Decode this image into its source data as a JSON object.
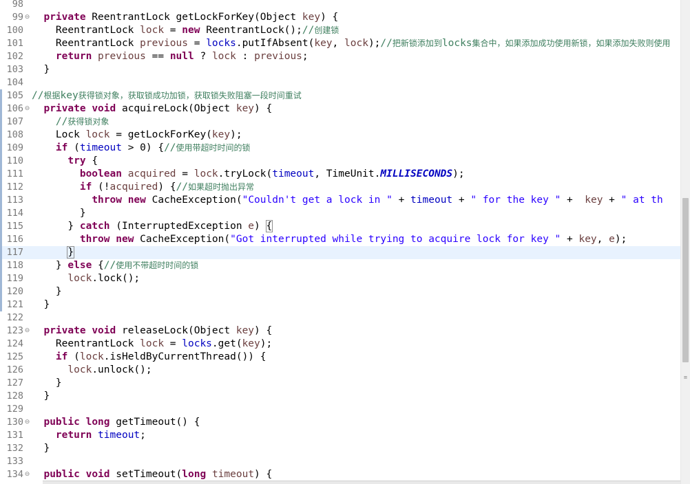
{
  "editor": {
    "lines": [
      {
        "num": "98",
        "fold": "",
        "tokens": []
      },
      {
        "num": "99",
        "fold": "minus",
        "tokens": [
          {
            "t": "  ",
            "c": ""
          },
          {
            "t": "private",
            "c": "kw"
          },
          {
            "t": " ReentrantLock getLockForKey(Object ",
            "c": ""
          },
          {
            "t": "key",
            "c": "var"
          },
          {
            "t": ") {",
            "c": ""
          }
        ]
      },
      {
        "num": "100",
        "fold": "",
        "tokens": [
          {
            "t": "    ReentrantLock ",
            "c": ""
          },
          {
            "t": "lock",
            "c": "var"
          },
          {
            "t": " = ",
            "c": ""
          },
          {
            "t": "new",
            "c": "kw"
          },
          {
            "t": " ReentrantLock();",
            "c": ""
          },
          {
            "t": "//",
            "c": "cmt"
          },
          {
            "t": "创建锁",
            "c": "cn"
          }
        ]
      },
      {
        "num": "101",
        "fold": "",
        "tokens": [
          {
            "t": "    ReentrantLock ",
            "c": ""
          },
          {
            "t": "previous",
            "c": "var"
          },
          {
            "t": " = ",
            "c": ""
          },
          {
            "t": "locks",
            "c": "fld"
          },
          {
            "t": ".putIfAbsent(",
            "c": ""
          },
          {
            "t": "key",
            "c": "var"
          },
          {
            "t": ", ",
            "c": ""
          },
          {
            "t": "lock",
            "c": "var"
          },
          {
            "t": ");",
            "c": ""
          },
          {
            "t": "//",
            "c": "cmt"
          },
          {
            "t": "把新锁添加到",
            "c": "cn"
          },
          {
            "t": "locks",
            "c": "cmt"
          },
          {
            "t": "集合中，如果添加成功使用新锁，如果添加失败则使用",
            "c": "cn"
          }
        ]
      },
      {
        "num": "102",
        "fold": "",
        "tokens": [
          {
            "t": "    ",
            "c": ""
          },
          {
            "t": "return",
            "c": "kw"
          },
          {
            "t": " ",
            "c": ""
          },
          {
            "t": "previous",
            "c": "var"
          },
          {
            "t": " == ",
            "c": ""
          },
          {
            "t": "null",
            "c": "kw"
          },
          {
            "t": " ? ",
            "c": ""
          },
          {
            "t": "lock",
            "c": "var"
          },
          {
            "t": " : ",
            "c": ""
          },
          {
            "t": "previous",
            "c": "var"
          },
          {
            "t": ";",
            "c": ""
          }
        ]
      },
      {
        "num": "103",
        "fold": "",
        "tokens": [
          {
            "t": "  }",
            "c": ""
          }
        ]
      },
      {
        "num": "104",
        "fold": "",
        "tokens": []
      },
      {
        "num": "105",
        "fold": "",
        "changed": true,
        "tokens": [
          {
            "t": "//",
            "c": "cmt"
          },
          {
            "t": "根据",
            "c": "cn"
          },
          {
            "t": "key",
            "c": "cmt"
          },
          {
            "t": "获得锁对象，获取锁成功加锁，获取锁失败阻塞一段时间重试",
            "c": "cn"
          }
        ]
      },
      {
        "num": "106",
        "fold": "minus",
        "changed": true,
        "tokens": [
          {
            "t": "  ",
            "c": ""
          },
          {
            "t": "private",
            "c": "kw"
          },
          {
            "t": " ",
            "c": ""
          },
          {
            "t": "void",
            "c": "kw"
          },
          {
            "t": " acquireLock(Object ",
            "c": ""
          },
          {
            "t": "key",
            "c": "var"
          },
          {
            "t": ") {",
            "c": ""
          }
        ]
      },
      {
        "num": "107",
        "fold": "",
        "changed": true,
        "tokens": [
          {
            "t": "    ",
            "c": ""
          },
          {
            "t": "//",
            "c": "cmt"
          },
          {
            "t": "获得锁对象",
            "c": "cn"
          }
        ]
      },
      {
        "num": "108",
        "fold": "",
        "changed": true,
        "tokens": [
          {
            "t": "    Lock ",
            "c": ""
          },
          {
            "t": "lock",
            "c": "var"
          },
          {
            "t": " = getLockForKey(",
            "c": ""
          },
          {
            "t": "key",
            "c": "var"
          },
          {
            "t": ");",
            "c": ""
          }
        ]
      },
      {
        "num": "109",
        "fold": "",
        "changed": true,
        "tokens": [
          {
            "t": "    ",
            "c": ""
          },
          {
            "t": "if",
            "c": "kw"
          },
          {
            "t": " (",
            "c": ""
          },
          {
            "t": "timeout",
            "c": "fld"
          },
          {
            "t": " > 0) {",
            "c": ""
          },
          {
            "t": "//",
            "c": "cmt"
          },
          {
            "t": "使用带超时时间的锁",
            "c": "cn"
          }
        ]
      },
      {
        "num": "110",
        "fold": "",
        "changed": true,
        "tokens": [
          {
            "t": "      ",
            "c": ""
          },
          {
            "t": "try",
            "c": "kw"
          },
          {
            "t": " {",
            "c": ""
          }
        ]
      },
      {
        "num": "111",
        "fold": "",
        "changed": true,
        "tokens": [
          {
            "t": "        ",
            "c": ""
          },
          {
            "t": "boolean",
            "c": "kw"
          },
          {
            "t": " ",
            "c": ""
          },
          {
            "t": "acquired",
            "c": "var"
          },
          {
            "t": " = ",
            "c": ""
          },
          {
            "t": "lock",
            "c": "var"
          },
          {
            "t": ".tryLock(",
            "c": ""
          },
          {
            "t": "timeout",
            "c": "fld"
          },
          {
            "t": ", TimeUnit.",
            "c": ""
          },
          {
            "t": "MILLISECONDS",
            "c": "cst"
          },
          {
            "t": ");",
            "c": ""
          }
        ]
      },
      {
        "num": "112",
        "fold": "",
        "changed": true,
        "tokens": [
          {
            "t": "        ",
            "c": ""
          },
          {
            "t": "if",
            "c": "kw"
          },
          {
            "t": " (!",
            "c": ""
          },
          {
            "t": "acquired",
            "c": "var"
          },
          {
            "t": ") {",
            "c": ""
          },
          {
            "t": "//",
            "c": "cmt"
          },
          {
            "t": "如果超时抛出异常",
            "c": "cn"
          }
        ]
      },
      {
        "num": "113",
        "fold": "",
        "changed": true,
        "tokens": [
          {
            "t": "          ",
            "c": ""
          },
          {
            "t": "throw",
            "c": "kw"
          },
          {
            "t": " ",
            "c": ""
          },
          {
            "t": "new",
            "c": "kw"
          },
          {
            "t": " CacheException(",
            "c": ""
          },
          {
            "t": "\"Couldn't get a lock in \"",
            "c": "str"
          },
          {
            "t": " + ",
            "c": ""
          },
          {
            "t": "timeout",
            "c": "fld"
          },
          {
            "t": " + ",
            "c": ""
          },
          {
            "t": "\" for the key \"",
            "c": "str"
          },
          {
            "t": " +  ",
            "c": ""
          },
          {
            "t": "key",
            "c": "var"
          },
          {
            "t": " + ",
            "c": ""
          },
          {
            "t": "\" at th",
            "c": "str"
          }
        ]
      },
      {
        "num": "114",
        "fold": "",
        "changed": true,
        "tokens": [
          {
            "t": "        }",
            "c": ""
          }
        ]
      },
      {
        "num": "115",
        "fold": "",
        "changed": true,
        "tokens": [
          {
            "t": "      } ",
            "c": ""
          },
          {
            "t": "catch",
            "c": "kw"
          },
          {
            "t": " (InterruptedException ",
            "c": ""
          },
          {
            "t": "e",
            "c": "var"
          },
          {
            "t": ") ",
            "c": ""
          },
          {
            "t": "{",
            "c": "brk"
          }
        ]
      },
      {
        "num": "116",
        "fold": "",
        "changed": true,
        "tokens": [
          {
            "t": "        ",
            "c": ""
          },
          {
            "t": "throw",
            "c": "kw"
          },
          {
            "t": " ",
            "c": ""
          },
          {
            "t": "new",
            "c": "kw"
          },
          {
            "t": " CacheException(",
            "c": ""
          },
          {
            "t": "\"Got interrupted while trying to acquire lock for key \"",
            "c": "str"
          },
          {
            "t": " + ",
            "c": ""
          },
          {
            "t": "key",
            "c": "var"
          },
          {
            "t": ", ",
            "c": ""
          },
          {
            "t": "e",
            "c": "var"
          },
          {
            "t": ");",
            "c": ""
          }
        ]
      },
      {
        "num": "117",
        "fold": "",
        "changed": true,
        "current": true,
        "tokens": [
          {
            "t": "      ",
            "c": ""
          },
          {
            "t": "}",
            "c": "brk"
          }
        ]
      },
      {
        "num": "118",
        "fold": "",
        "changed": true,
        "tokens": [
          {
            "t": "    } ",
            "c": ""
          },
          {
            "t": "else",
            "c": "kw"
          },
          {
            "t": " {",
            "c": ""
          },
          {
            "t": "//",
            "c": "cmt"
          },
          {
            "t": "使用不带超时时间的锁",
            "c": "cn"
          }
        ]
      },
      {
        "num": "119",
        "fold": "",
        "changed": true,
        "tokens": [
          {
            "t": "      ",
            "c": ""
          },
          {
            "t": "lock",
            "c": "var"
          },
          {
            "t": ".lock();",
            "c": ""
          }
        ]
      },
      {
        "num": "120",
        "fold": "",
        "changed": true,
        "tokens": [
          {
            "t": "    }",
            "c": ""
          }
        ]
      },
      {
        "num": "121",
        "fold": "",
        "changed": true,
        "tokens": [
          {
            "t": "  }",
            "c": ""
          }
        ]
      },
      {
        "num": "122",
        "fold": "",
        "tokens": []
      },
      {
        "num": "123",
        "fold": "minus",
        "tokens": [
          {
            "t": "  ",
            "c": ""
          },
          {
            "t": "private",
            "c": "kw"
          },
          {
            "t": " ",
            "c": ""
          },
          {
            "t": "void",
            "c": "kw"
          },
          {
            "t": " releaseLock(Object ",
            "c": ""
          },
          {
            "t": "key",
            "c": "var"
          },
          {
            "t": ") {",
            "c": ""
          }
        ]
      },
      {
        "num": "124",
        "fold": "",
        "tokens": [
          {
            "t": "    ReentrantLock ",
            "c": ""
          },
          {
            "t": "lock",
            "c": "var"
          },
          {
            "t": " = ",
            "c": ""
          },
          {
            "t": "locks",
            "c": "fld"
          },
          {
            "t": ".get(",
            "c": ""
          },
          {
            "t": "key",
            "c": "var"
          },
          {
            "t": ");",
            "c": ""
          }
        ]
      },
      {
        "num": "125",
        "fold": "",
        "tokens": [
          {
            "t": "    ",
            "c": ""
          },
          {
            "t": "if",
            "c": "kw"
          },
          {
            "t": " (",
            "c": ""
          },
          {
            "t": "lock",
            "c": "var"
          },
          {
            "t": ".isHeldByCurrentThread()) {",
            "c": ""
          }
        ]
      },
      {
        "num": "126",
        "fold": "",
        "tokens": [
          {
            "t": "      ",
            "c": ""
          },
          {
            "t": "lock",
            "c": "var"
          },
          {
            "t": ".unlock();",
            "c": ""
          }
        ]
      },
      {
        "num": "127",
        "fold": "",
        "tokens": [
          {
            "t": "    }",
            "c": ""
          }
        ]
      },
      {
        "num": "128",
        "fold": "",
        "tokens": [
          {
            "t": "  }",
            "c": ""
          }
        ]
      },
      {
        "num": "129",
        "fold": "",
        "tokens": []
      },
      {
        "num": "130",
        "fold": "minus",
        "tokens": [
          {
            "t": "  ",
            "c": ""
          },
          {
            "t": "public",
            "c": "kw"
          },
          {
            "t": " ",
            "c": ""
          },
          {
            "t": "long",
            "c": "kw"
          },
          {
            "t": " getTimeout() {",
            "c": ""
          }
        ]
      },
      {
        "num": "131",
        "fold": "",
        "tokens": [
          {
            "t": "    ",
            "c": ""
          },
          {
            "t": "return",
            "c": "kw"
          },
          {
            "t": " ",
            "c": ""
          },
          {
            "t": "timeout",
            "c": "fld"
          },
          {
            "t": ";",
            "c": ""
          }
        ]
      },
      {
        "num": "132",
        "fold": "",
        "tokens": [
          {
            "t": "  }",
            "c": ""
          }
        ]
      },
      {
        "num": "133",
        "fold": "",
        "tokens": []
      },
      {
        "num": "134",
        "fold": "minus",
        "tokens": [
          {
            "t": "  ",
            "c": ""
          },
          {
            "t": "public",
            "c": "kw"
          },
          {
            "t": " ",
            "c": ""
          },
          {
            "t": "void",
            "c": "kw"
          },
          {
            "t": " setTimeout(",
            "c": ""
          },
          {
            "t": "long",
            "c": "kw"
          },
          {
            "t": " ",
            "c": ""
          },
          {
            "t": "timeout",
            "c": "var"
          },
          {
            "t": ") {",
            "c": ""
          }
        ]
      }
    ]
  },
  "scrollbar": {
    "vertical_position": 0.62,
    "vertical_visible_fraction": 0.34
  }
}
